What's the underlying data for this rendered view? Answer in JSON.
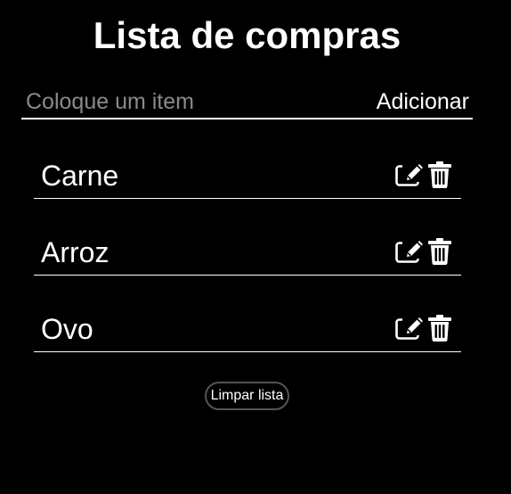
{
  "header": {
    "title": "Lista de compras"
  },
  "form": {
    "placeholder": "Coloque um item",
    "value": "",
    "add_label": "Adicionar"
  },
  "list": {
    "items": [
      {
        "label": "Carne",
        "edit_icon": "edit-icon",
        "delete_icon": "trash-icon"
      },
      {
        "label": "Arroz",
        "edit_icon": "edit-icon",
        "delete_icon": "trash-icon"
      },
      {
        "label": "Ovo",
        "edit_icon": "edit-icon",
        "delete_icon": "trash-icon"
      }
    ]
  },
  "footer": {
    "clear_label": "Limpar lista"
  },
  "colors": {
    "background": "#000000",
    "foreground": "#ffffff",
    "placeholder": "#8a8a8a"
  }
}
